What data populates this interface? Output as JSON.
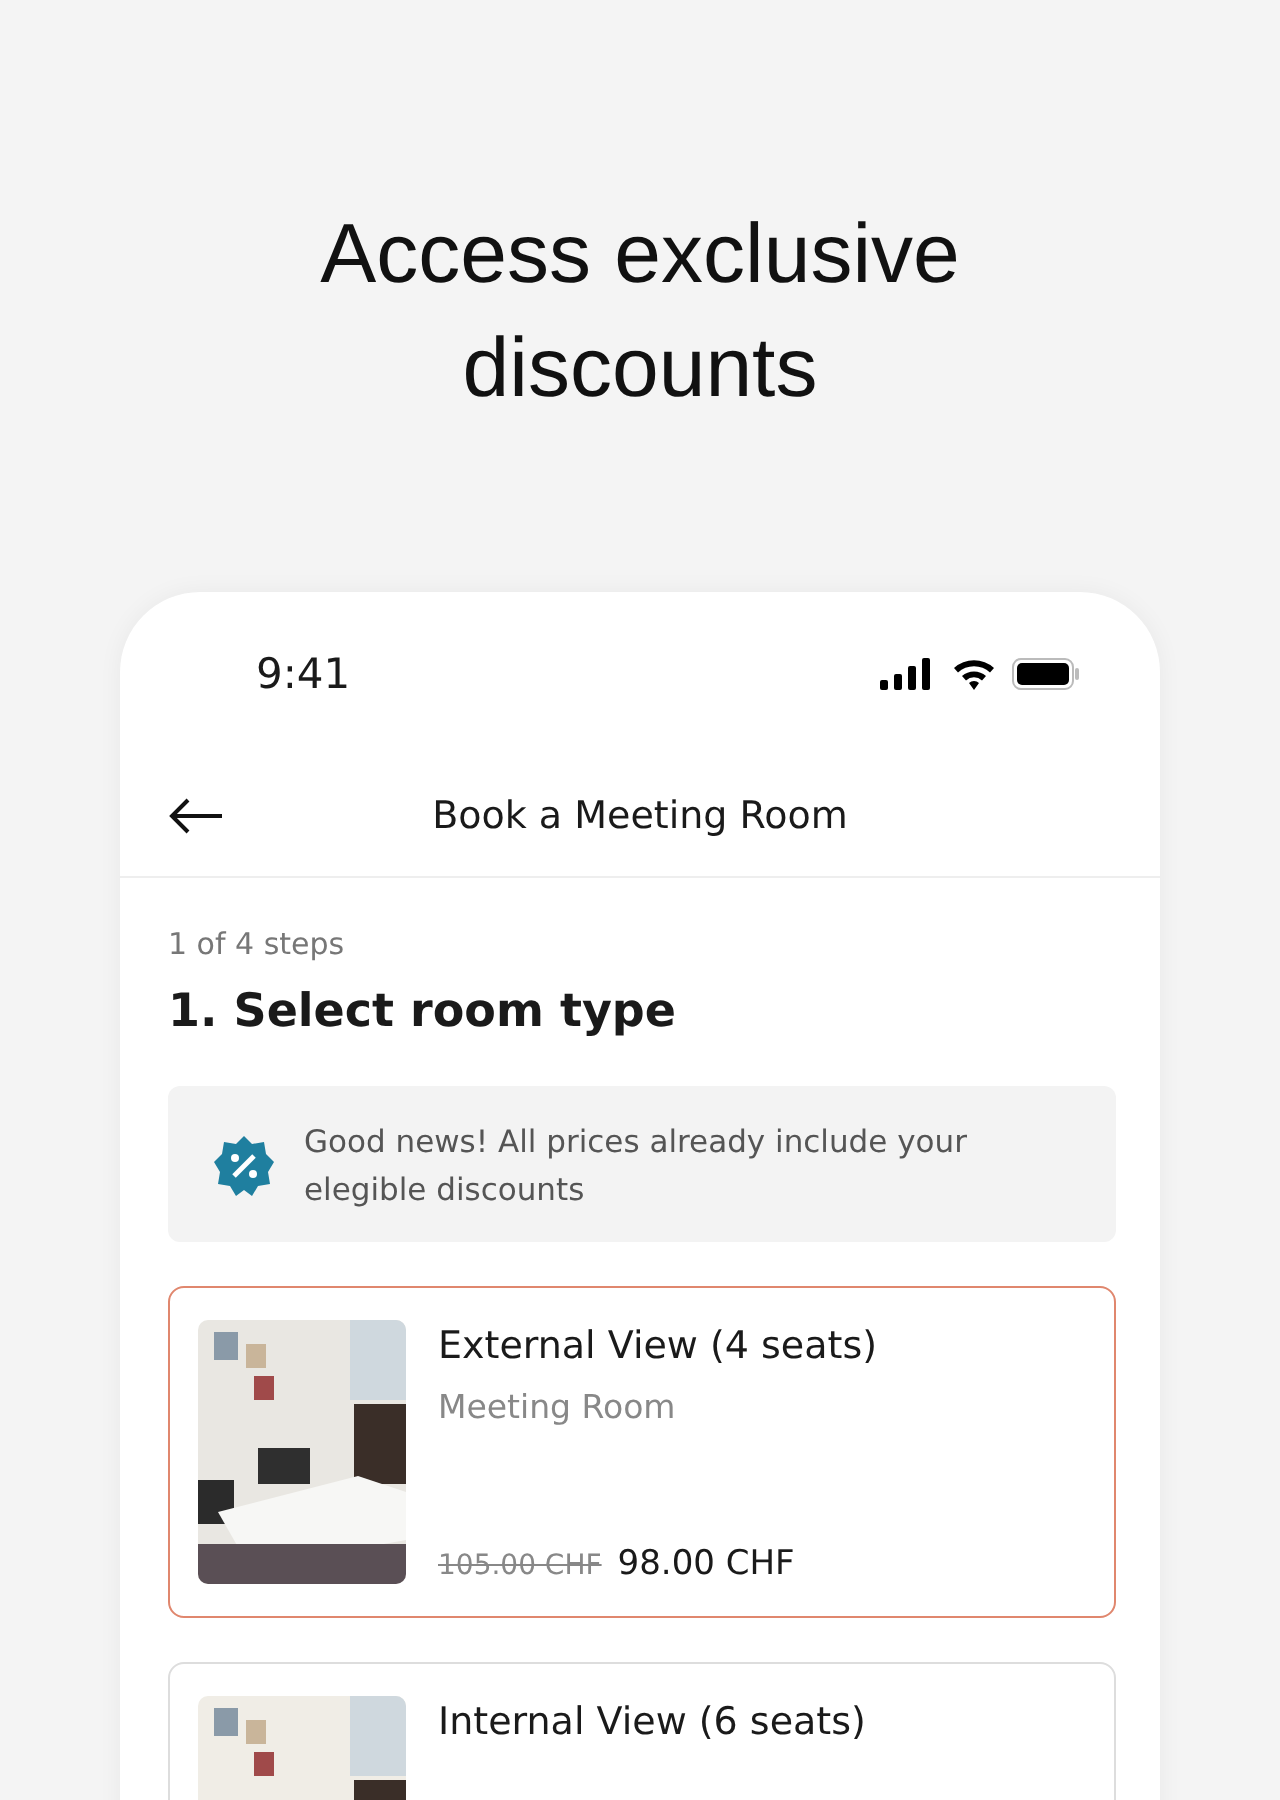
{
  "headline": "Access exclusive discounts",
  "status_bar": {
    "time": "9:41"
  },
  "header": {
    "title": "Book a Meeting Room"
  },
  "step": {
    "progress": "1 of 4 steps",
    "title": "1. Select room type"
  },
  "notice": {
    "text": "Good news! All prices already include your elegible discounts"
  },
  "rooms": [
    {
      "name": "External View (4 seats)",
      "type": "Meeting Room",
      "old_price": "105.00 CHF",
      "price": "98.00 CHF",
      "selected": true
    },
    {
      "name": "Internal View (6 seats)",
      "selected": false
    }
  ]
}
